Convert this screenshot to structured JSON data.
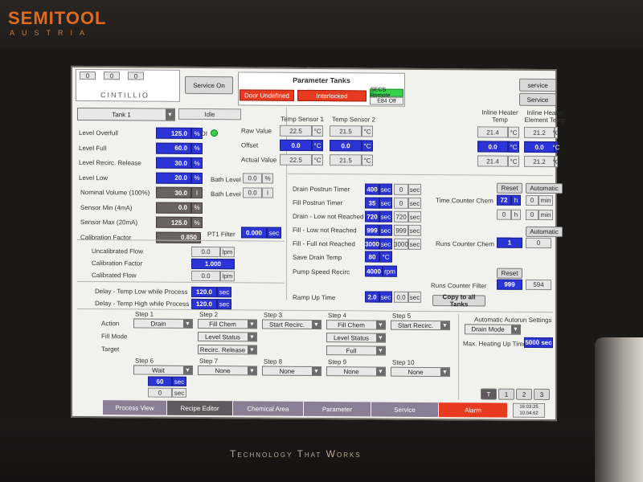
{
  "brand": {
    "name": "SEMITOOL",
    "sub": "AUSTRIA"
  },
  "slogan": "Technology That Works",
  "header": {
    "logo": "CINTILLIO",
    "logo_digits": [
      "0",
      "0",
      "0"
    ],
    "service_on": "Service On",
    "title": "Parameter Tanks",
    "door": "Door Undefined",
    "interlock": "Interlocked",
    "secs": "SECS Remote",
    "e84": "E84 Off",
    "service_btn1": "service",
    "service_btn2": "Service"
  },
  "tank": {
    "select": "Tank 1",
    "state": "Idle",
    "di": "DI"
  },
  "levels": [
    {
      "label": "Level Overfull",
      "value": "125.0",
      "unit": "%"
    },
    {
      "label": "Level Full",
      "value": "60.0",
      "unit": "%"
    },
    {
      "label": "Level Recirc. Release",
      "value": "30.0",
      "unit": "%"
    },
    {
      "label": "Level Low",
      "value": "20.0",
      "unit": "%"
    },
    {
      "label": "Nominal Volume (100%)",
      "value": "30.0",
      "unit": "l"
    },
    {
      "label": "Sensor Min (4mA)",
      "value": "0.0",
      "unit": "%"
    },
    {
      "label": "Sensor Max (20mA)",
      "value": "125.0",
      "unit": "%"
    },
    {
      "label": "Calibration Factor",
      "value": "0.850",
      "unit": ""
    }
  ],
  "bath": {
    "level_label1": "Bath Level",
    "level_value1": "0.0",
    "level_unit1": "%",
    "level_label2": "Bath Level",
    "level_value2": "0.0",
    "level_unit2": "l",
    "pt1_label": "PT1 Filter",
    "pt1_value": "0.000",
    "pt1_unit": "sec"
  },
  "temps": {
    "sensor1": "Temp Sensor 1",
    "sensor2": "Temp Sensor 2",
    "inline_heater": "Inline Heater Temp",
    "inline_element": "Inline Heater Element Temp",
    "rows": [
      {
        "label": "Raw Value",
        "s1": "22.5",
        "s2": "21.5",
        "h1": "21.4",
        "h2": "21.2"
      },
      {
        "label": "Offset",
        "s1": "0.0",
        "s2": "0.0",
        "h1": "0.0",
        "h2": "0.0"
      },
      {
        "label": "Actual Value",
        "s1": "22.5",
        "s2": "21.5",
        "h1": "21.4",
        "h2": "21.2"
      }
    ],
    "unit": "°C"
  },
  "timers": [
    {
      "label": "Drain Postrun Timer",
      "set": "400",
      "act": "0",
      "unit": "sec"
    },
    {
      "label": "Fill Postrun Timer",
      "set": "35",
      "act": "0",
      "unit": "sec"
    },
    {
      "label": "Drain - Low not Reached",
      "set": "720",
      "act": "720",
      "unit": "sec"
    },
    {
      "label": "Fill - Low not Reached",
      "set": "999",
      "act": "999",
      "unit": "sec"
    },
    {
      "label": "Fill - Full not Reached",
      "set": "3000",
      "act": "3000",
      "unit": "sec"
    }
  ],
  "save_drain": {
    "label": "Save Drain Temp",
    "value": "80",
    "unit": "°C"
  },
  "pump": {
    "label": "Pump Speed Recirc",
    "value": "4000",
    "unit": "rpm"
  },
  "ramp": {
    "label": "Ramp Up Time",
    "set": "2.0",
    "act": "0.0",
    "unit": "sec",
    "copy": "Copy to all Tanks"
  },
  "counters": {
    "reset": "Reset",
    "automatic": "Automatic",
    "time_label": "Time Counter Chem",
    "time_h_set": "72",
    "time_h_unit": "h",
    "time_min_set": "0",
    "time_min_unit": "min",
    "time_h_act": "0",
    "time_min_act": "0",
    "runs_label": "Runs Counter Chem",
    "runs_automatic": "Automatic",
    "runs_set": "1",
    "runs_act": "0",
    "filter_reset": "Reset",
    "filter_label": "Runs Counter Filter",
    "filter_set": "999",
    "filter_act": "594"
  },
  "flow": [
    {
      "label": "Uncalibrated Flow",
      "value": "0.0",
      "unit": "lpm",
      "style": "gray"
    },
    {
      "label": "Calibration Factor",
      "value": "1.000",
      "unit": "",
      "style": "blue"
    },
    {
      "label": "Calibrated Flow",
      "value": "0.0",
      "unit": "lpm",
      "style": "gray"
    }
  ],
  "delays": [
    {
      "label": "Delay - Temp Low while Process",
      "value": "120.0",
      "unit": "sec"
    },
    {
      "label": "Delay - Temp High while Process",
      "value": "120.0",
      "unit": "sec"
    }
  ],
  "steps": {
    "row_labels": [
      "Action",
      "Fill Mode",
      "Target"
    ],
    "top": [
      {
        "name": "Step 1",
        "action": "Drain"
      },
      {
        "name": "Step 2",
        "action": "Fill Chem",
        "fill_mode": "Level Status",
        "target": "Recirc. Release"
      },
      {
        "name": "Step 3",
        "action": "Start Recirc."
      },
      {
        "name": "Step 4",
        "action": "Fill Chem",
        "fill_mode": "Level Status",
        "target": "Full"
      },
      {
        "name": "Step 5",
        "action": "Start Recirc."
      }
    ],
    "bottom": [
      {
        "name": "Step 6",
        "action": "Wait",
        "t1": "60",
        "t2": "0",
        "unit": "sec"
      },
      {
        "name": "Step 7",
        "action": "None"
      },
      {
        "name": "Step 8",
        "action": "None"
      },
      {
        "name": "Step 9",
        "action": "None"
      },
      {
        "name": "Step 10",
        "action": "None"
      }
    ],
    "autorun_label": "Automatic Autorun Settings",
    "autorun_mode": "Drain Mode",
    "max_heating_label": "Max. Heating Up Time",
    "max_heating_value": "5000 sec"
  },
  "pager": [
    "T",
    "1",
    "2",
    "3"
  ],
  "tabs": [
    "Process View",
    "Recipe Editor",
    "Chemical Area",
    "Parameter",
    "Service",
    "Alarm"
  ],
  "clock": {
    "time": "16:03:25",
    "date": "10.04.62"
  },
  "colors": {
    "accent_blue": "#2b34d6",
    "alarm_red": "#e83a1f",
    "ok_green": "#36d24a"
  }
}
